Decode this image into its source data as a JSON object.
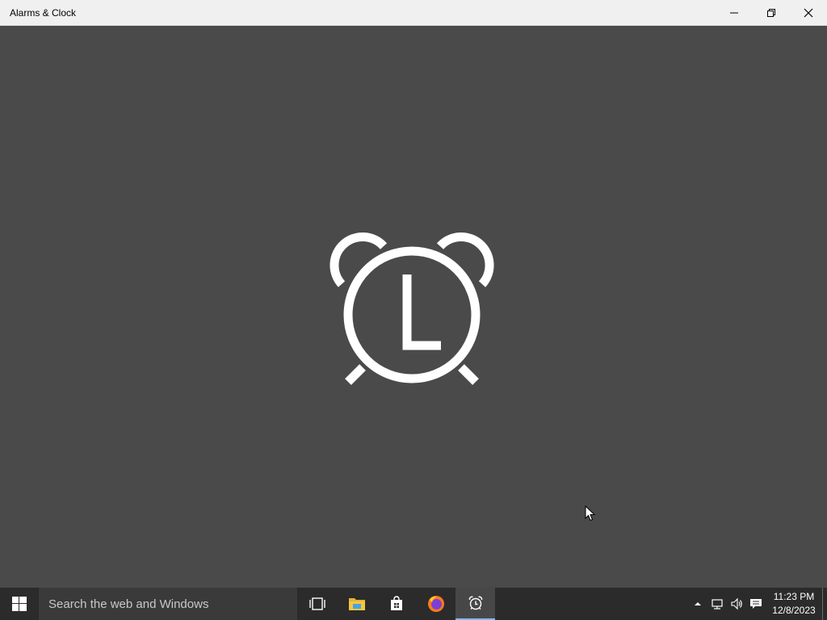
{
  "window": {
    "title": "Alarms & Clock",
    "controls": {
      "minimize_icon": "minimize-icon",
      "restore_icon": "restore-icon",
      "close_icon": "close-icon"
    }
  },
  "splash": {
    "icon": "alarm-clock-icon",
    "background": "#4a4a4a",
    "icon_color": "#ffffff"
  },
  "taskbar": {
    "start_icon": "windows-logo-icon",
    "search": {
      "placeholder": "Search the web and Windows"
    },
    "apps": [
      {
        "name": "task-view",
        "icon": "task-view-icon"
      },
      {
        "name": "file-explorer",
        "icon": "folder-icon"
      },
      {
        "name": "store",
        "icon": "store-bag-icon"
      },
      {
        "name": "firefox",
        "icon": "firefox-icon"
      },
      {
        "name": "alarms-clock",
        "icon": "alarm-clock-icon",
        "active": true
      }
    ],
    "tray": {
      "icons": [
        "chevron-up-icon",
        "network-icon",
        "volume-icon",
        "action-center-icon"
      ],
      "time": "11:23 PM",
      "date": "12/8/2023"
    }
  }
}
